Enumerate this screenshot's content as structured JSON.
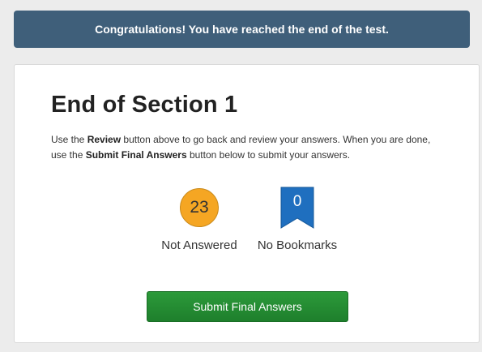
{
  "banner": {
    "message": "Congratulations! You have reached the end of the test."
  },
  "section": {
    "title": "End of Section 1",
    "instructions": {
      "part1": "Use the ",
      "review_label": "Review",
      "part2": " button above to go back and review your answers. When you are done, use the ",
      "submit_label": "Submit Final Answers",
      "part3": " button below to submit your answers."
    }
  },
  "stats": {
    "not_answered": {
      "count": "23",
      "label": "Not Answered",
      "icon": "circle-badge-icon",
      "color": "#f5a623"
    },
    "bookmarks": {
      "count": "0",
      "label": "No Bookmarks",
      "icon": "bookmark-icon",
      "color": "#1f6fbf"
    }
  },
  "actions": {
    "submit_label": "Submit Final Answers",
    "submit_color": "#23893a"
  },
  "colors": {
    "banner": "#3f5f7a",
    "background": "#ececec"
  }
}
